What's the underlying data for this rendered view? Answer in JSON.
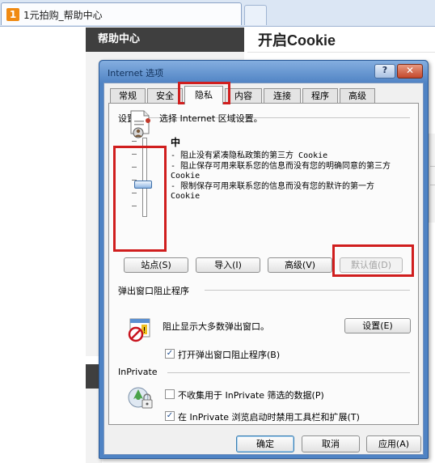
{
  "browser": {
    "tab_logo": "1",
    "tab_title": "1元拍购_帮助中心"
  },
  "page": {
    "sidebar_heading": "帮助中心",
    "title": "开启Cookie"
  },
  "dialog": {
    "title": "Internet 选项",
    "help_glyph": "?",
    "close_glyph": "✕",
    "tabs": [
      {
        "label": "常规",
        "selected": false
      },
      {
        "label": "安全",
        "selected": false
      },
      {
        "label": "隐私",
        "selected": true
      },
      {
        "label": "内容",
        "selected": false
      },
      {
        "label": "连接",
        "selected": false
      },
      {
        "label": "程序",
        "selected": false
      },
      {
        "label": "高级",
        "selected": false
      }
    ],
    "settings": {
      "group_label": "设置",
      "zone_text": "选择 Internet 区域设置。",
      "level_name": "中",
      "slider_level": 0.4,
      "level_description": [
        "- 阻止没有紧凑隐私政策的第三方 Cookie",
        "- 阻止保存可用来联系您的信息而没有您的明确同意的第三方 Cookie",
        "- 限制保存可用来联系您的信息而没有您的默许的第一方 Cookie"
      ],
      "buttons": {
        "sites": "站点(S)",
        "import": "导入(I)",
        "advanced": "高级(V)",
        "default": "默认值(D)"
      }
    },
    "popup_blocker": {
      "group_label": "弹出窗口阻止程序",
      "description": "阻止显示大多数弹出窗口。",
      "settings_button": "设置(E)",
      "checkbox_label": "打开弹出窗口阻止程序(B)",
      "checked": true
    },
    "inprivate": {
      "group_label": "InPrivate",
      "checkbox1_label": "不收集用于 InPrivate 筛选的数据(P)",
      "checkbox1_checked": false,
      "checkbox2_label": "在 InPrivate 浏览启动时禁用工具栏和扩展(T)",
      "checkbox2_checked": true
    },
    "footer": {
      "ok": "确定",
      "cancel": "取消",
      "apply": "应用(A)"
    },
    "check_glyph": "✓"
  },
  "colors": {
    "highlight_red": "#d01e1e",
    "dialog_frame": "#4f83c4"
  }
}
